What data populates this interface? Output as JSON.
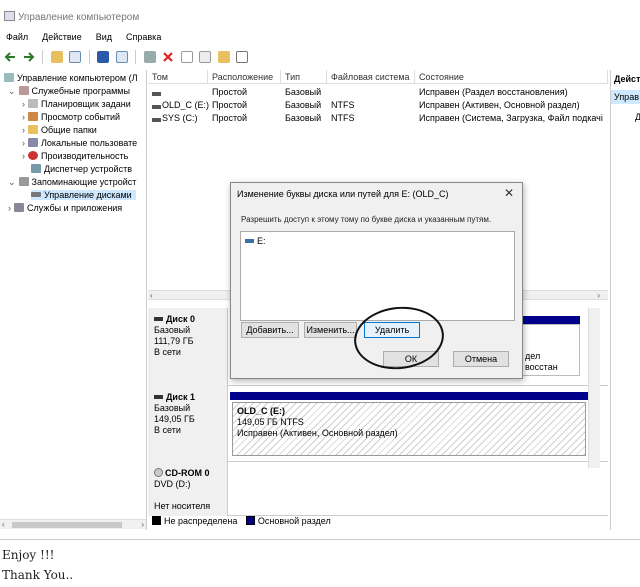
{
  "window": {
    "title": "Управление компьютером"
  },
  "menu": [
    "Файл",
    "Действие",
    "Вид",
    "Справка"
  ],
  "tree": [
    {
      "label": "Управление компьютером (Л",
      "indent": 0,
      "arrow": ""
    },
    {
      "label": "Служебные программы",
      "indent": 1,
      "arrow": "v"
    },
    {
      "label": "Планировщик задани",
      "indent": 2,
      "arrow": ">"
    },
    {
      "label": "Просмотр событий",
      "indent": 2,
      "arrow": ">"
    },
    {
      "label": "Общие папки",
      "indent": 2,
      "arrow": ">"
    },
    {
      "label": "Локальные пользовате",
      "indent": 2,
      "arrow": ">"
    },
    {
      "label": "Производительность",
      "indent": 2,
      "arrow": ">"
    },
    {
      "label": "Диспетчер устройств",
      "indent": 2,
      "arrow": ""
    },
    {
      "label": "Запоминающие устройст",
      "indent": 1,
      "arrow": "v"
    },
    {
      "label": "Управление дисками",
      "indent": 2,
      "arrow": ""
    },
    {
      "label": "Службы и приложения",
      "indent": 1,
      "arrow": ">"
    }
  ],
  "volume_table": {
    "headers": [
      "Том",
      "Расположение",
      "Тип",
      "Файловая система",
      "Состояние"
    ],
    "rows": [
      {
        "name": "",
        "layout": "Простой",
        "type": "Базовый",
        "fs": "",
        "status": "Исправен (Раздел восстановления)"
      },
      {
        "name": "OLD_C (E:)",
        "layout": "Простой",
        "type": "Базовый",
        "fs": "NTFS",
        "status": "Исправен (Активен, Основной раздел)"
      },
      {
        "name": "SYS (C:)",
        "layout": "Простой",
        "type": "Базовый",
        "fs": "NTFS",
        "status": "Исправен (Система, Загрузка, Файл подкачі"
      }
    ]
  },
  "actions_pane": {
    "header": "Дейст",
    "item": "Управ",
    "sub": "Д"
  },
  "disks": [
    {
      "name": "Диск 0",
      "type": "Базовый",
      "size": "111,79 ГБ",
      "state": "В сети",
      "volume_text": "дел восстан"
    },
    {
      "name": "Диск 1",
      "type": "Базовый",
      "size": "149,05 ГБ",
      "state": "В сети",
      "volume": {
        "name": "OLD_C  (E:)",
        "size": "149,05 ГБ NTFS",
        "status": "Исправен (Активен, Основной раздел)"
      }
    },
    {
      "name": "CD-ROM 0",
      "type": "DVD (D:)",
      "size": "",
      "state": "Нет носителя"
    }
  ],
  "legend": {
    "unallocated": "Не распределена",
    "primary": "Основной раздел"
  },
  "dialog": {
    "title": "Изменение буквы диска или путей для E: (OLD_C)",
    "close": "✕",
    "text": "Разрешить доступ к этому тому по букве диска и указанным путям.",
    "list_item": "E:",
    "add": "Добавить...",
    "change": "Изменить...",
    "remove": "Удалить",
    "ok": "ОК",
    "cancel": "Отмена"
  },
  "caption": {
    "line1": "Enjoy !!!",
    "line2": "Thank You.."
  },
  "colors": {
    "primary_partition": "#00008b",
    "selection": "#cde8ff",
    "accent": "#0078d7"
  }
}
